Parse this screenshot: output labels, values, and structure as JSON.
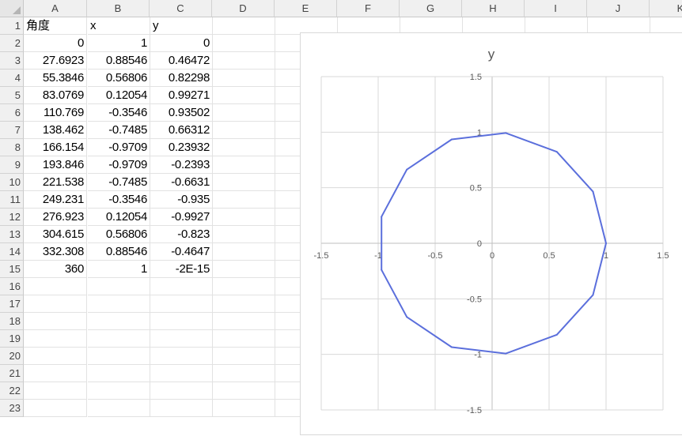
{
  "columns": [
    "A",
    "B",
    "C",
    "D",
    "E",
    "F",
    "G",
    "H",
    "I",
    "J",
    "K"
  ],
  "rows": [
    "1",
    "2",
    "3",
    "4",
    "5",
    "6",
    "7",
    "8",
    "9",
    "10",
    "11",
    "12",
    "13",
    "14",
    "15",
    "16",
    "17",
    "18",
    "19",
    "20",
    "21",
    "22",
    "23"
  ],
  "headers": [
    "角度",
    "x",
    "y"
  ],
  "table": [
    [
      "0",
      "1",
      "0"
    ],
    [
      "27.6923",
      "0.88546",
      "0.46472"
    ],
    [
      "55.3846",
      "0.56806",
      "0.82298"
    ],
    [
      "83.0769",
      "0.12054",
      "0.99271"
    ],
    [
      "110.769",
      "-0.3546",
      "0.93502"
    ],
    [
      "138.462",
      "-0.7485",
      "0.66312"
    ],
    [
      "166.154",
      "-0.9709",
      "0.23932"
    ],
    [
      "193.846",
      "-0.9709",
      "-0.2393"
    ],
    [
      "221.538",
      "-0.7485",
      "-0.6631"
    ],
    [
      "249.231",
      "-0.3546",
      "-0.935"
    ],
    [
      "276.923",
      "0.12054",
      "-0.9927"
    ],
    [
      "304.615",
      "0.56806",
      "-0.823"
    ],
    [
      "332.308",
      "0.88546",
      "-0.4647"
    ],
    [
      "360",
      "1",
      "-2E-15"
    ]
  ],
  "chart_data": {
    "type": "scatter",
    "title": "y",
    "xlabel": "",
    "ylabel": "",
    "xlim": [
      -1.5,
      1.5
    ],
    "ylim": [
      -1.5,
      1.5
    ],
    "x_ticks": [
      "-1.5",
      "-1",
      "-0.5",
      "0",
      "0.5",
      "1",
      "1.5"
    ],
    "y_ticks": [
      "1.5",
      "1",
      "0.5",
      "0",
      "-0.5",
      "-1",
      "-1.5"
    ],
    "grid": true,
    "line_color": "#5b6fdc",
    "series": [
      {
        "x": [
          1,
          0.88546,
          0.56806,
          0.12054,
          -0.3546,
          -0.7485,
          -0.9709,
          -0.9709,
          -0.7485,
          -0.3546,
          0.12054,
          0.56806,
          0.88546,
          1
        ],
        "y": [
          0,
          0.46472,
          0.82298,
          0.99271,
          0.93502,
          0.66312,
          0.23932,
          -0.2393,
          -0.6631,
          -0.935,
          -0.9927,
          -0.823,
          -0.4647,
          0
        ]
      }
    ]
  }
}
